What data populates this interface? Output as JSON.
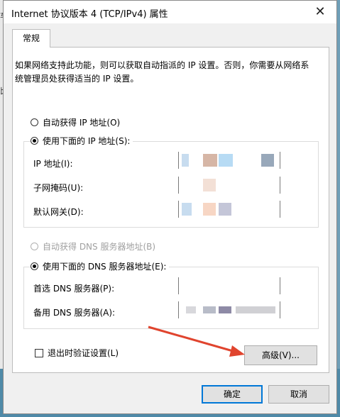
{
  "dialog": {
    "title": "Internet 协议版本 4 (TCP/IPv4) 属性",
    "close_glyph": "✕"
  },
  "tab": {
    "label": "常规"
  },
  "description": "如果网络支持此功能，则可以获取自动指派的 IP 设置。否则，你需要从网络系统管理员处获得适当的 IP 设置。",
  "ip_section": {
    "auto_label": "自动获得 IP 地址(O)",
    "manual_label": "使用下面的 IP 地址(S):",
    "selected": "manual",
    "fields": [
      {
        "label": "IP 地址(I):"
      },
      {
        "label": "子网掩码(U):"
      },
      {
        "label": "默认网关(D):"
      }
    ]
  },
  "dns_section": {
    "auto_label": "自动获得 DNS 服务器地址(B)",
    "manual_label": "使用下面的 DNS 服务器地址(E):",
    "selected": "manual",
    "fields": [
      {
        "label": "首选 DNS 服务器(P):"
      },
      {
        "label": "备用 DNS 服务器(A):"
      }
    ]
  },
  "validate_on_exit": {
    "label": "退出时验证设置(L)",
    "checked": false
  },
  "buttons": {
    "advanced": "高级(V)...",
    "ok": "确定",
    "cancel": "取消"
  },
  "background": {
    "left_fragments": [
      "车",
      "",
      "比",
      "",
      "",
      "",
      "",
      "",
      "",
      "",
      ""
    ]
  },
  "colors": {
    "accent": "#0078d7",
    "annotation_arrow": "#e0442e"
  }
}
